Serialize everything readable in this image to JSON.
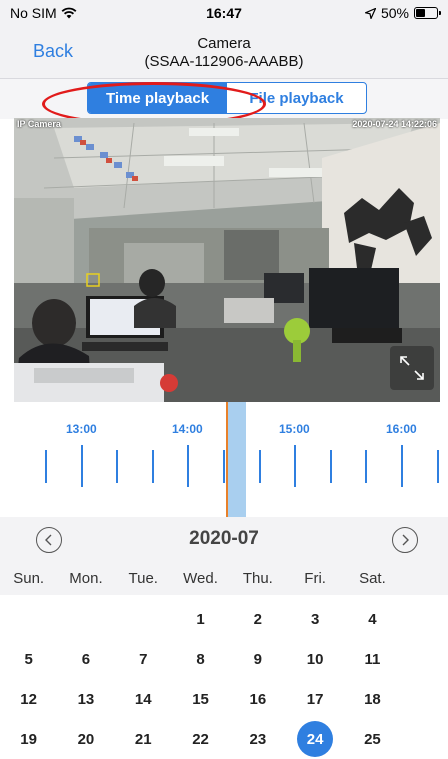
{
  "status_bar": {
    "carrier": "No SIM",
    "time": "16:47",
    "battery": "50%",
    "battery_level": 0.5
  },
  "nav": {
    "back_label": "Back",
    "title_line1": "Camera",
    "title_line2": "(SSAA-112906-AAABB)"
  },
  "playback_tabs": [
    {
      "label": "Time playback",
      "active": true
    },
    {
      "label": "File playback",
      "active": false
    }
  ],
  "video": {
    "overlay_name": "IP Camera",
    "overlay_timestamp": "2020-07-24 14:22:06"
  },
  "timeline": {
    "labels": [
      "13:00",
      "14:00",
      "15:00",
      "16:00"
    ]
  },
  "calendar": {
    "month_title": "2020-07",
    "weekdays": [
      "Sun.",
      "Mon.",
      "Tue.",
      "Wed.",
      "Thu.",
      "Fri.",
      "Sat."
    ],
    "weeks": [
      [
        "",
        "",
        "",
        "1",
        "2",
        "3",
        "4"
      ],
      [
        "5",
        "6",
        "7",
        "8",
        "9",
        "10",
        "11"
      ],
      [
        "12",
        "13",
        "14",
        "15",
        "16",
        "17",
        "18"
      ],
      [
        "19",
        "20",
        "21",
        "22",
        "23",
        "24",
        "25"
      ]
    ],
    "selected_day": "24"
  },
  "colors": {
    "accent": "#2f7fe0",
    "annotation": "#e11b1b",
    "cursor": "#e8812a",
    "highlight": "#a9cfef"
  }
}
